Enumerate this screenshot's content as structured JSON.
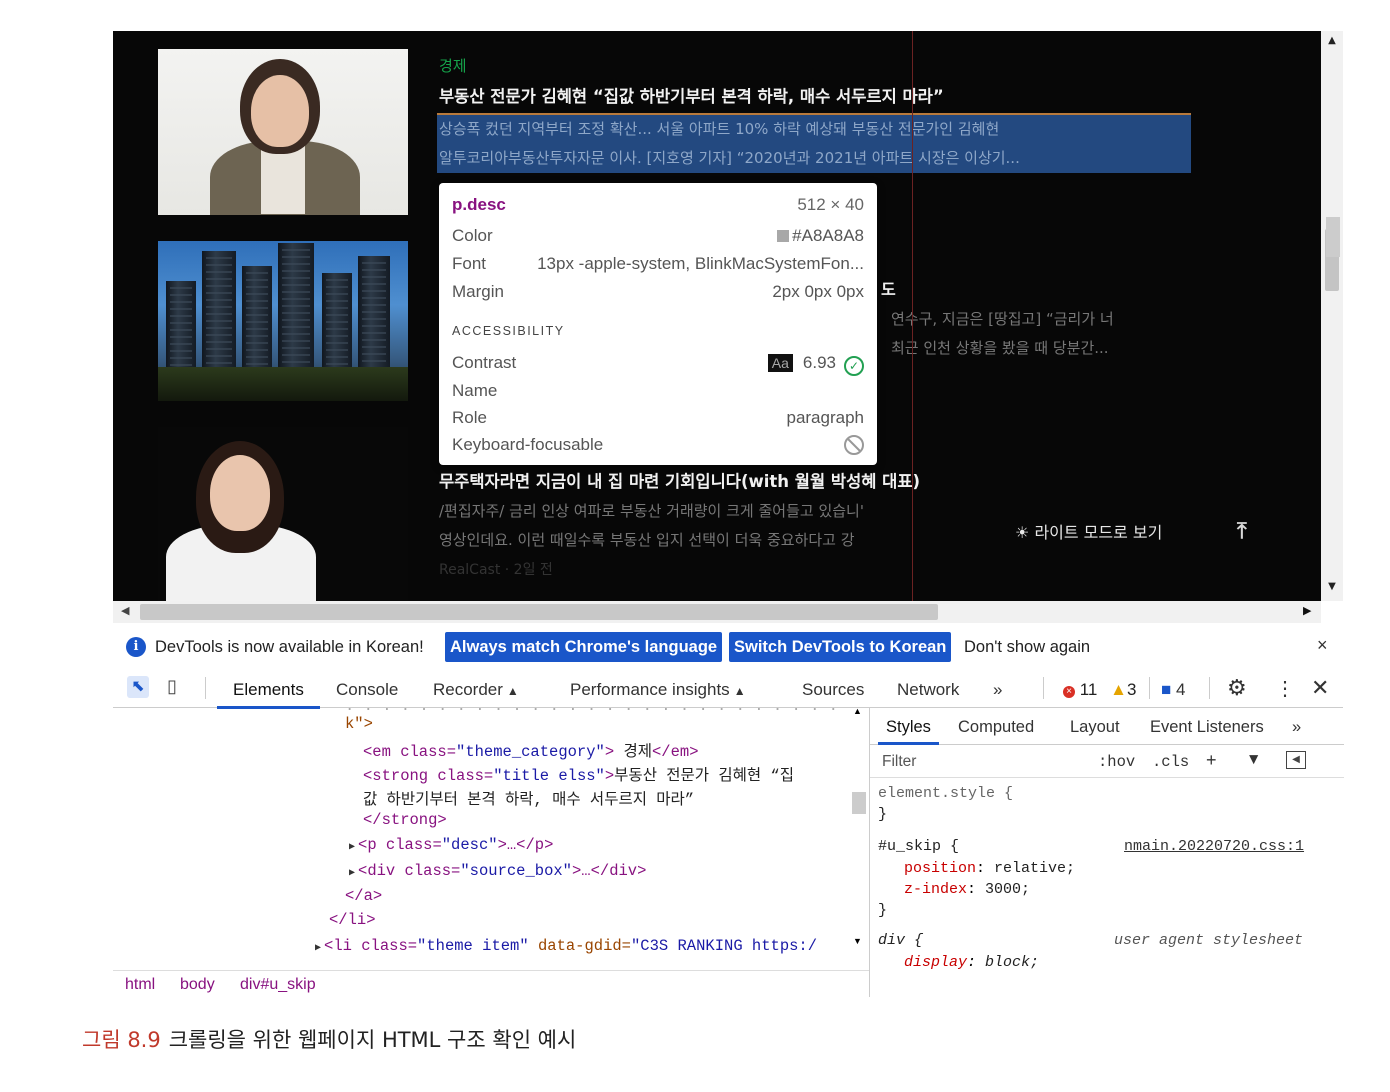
{
  "page": {
    "article1": {
      "category": "경제",
      "title": "부동산 전문가 김혜현 “집값 하반기부터 본격 하락, 매수 서두르지 마라”",
      "desc_line1": "상승폭 컸던 지역부터 조정 확산... 서울 아파트 10% 하락 예상돼 부동산 전문가인 김혜현",
      "desc_line2": "알투코리아부동산투자자문 이사. [지호영 기자] “2020년과 2021년 아파트 시장은 이상기..."
    },
    "article2": {
      "title_fragment": "도",
      "desc_line1": "연수구, 지금은 [땅집고] “금리가 너",
      "desc_line2": "최근 인천 상황을 봤을 때 당분간..."
    },
    "article3": {
      "title": "무주택자라면 지금이 내 집 마련 기회입니다(with 월월 박성혜 대표)",
      "desc_line1": "/편집자주/ 금리 인상 여파로 부동산 거래량이 크게 줄어들고 있습니'",
      "desc_line2": "영상인데요. 이런 때일수록 부동산 입지 선택이 더욱 중요하다고 강",
      "source": "RealCast · 2일 전"
    },
    "light_mode_label": "라이트 모드로 보기",
    "sun_icon": "☀",
    "top_icon": "⤒"
  },
  "tooltip": {
    "element": "p.desc",
    "size": "512 × 40",
    "color_label": "Color",
    "color_value": "#A8A8A8",
    "font_label": "Font",
    "font_value": "13px -apple-system, BlinkMacSystemFon...",
    "margin_label": "Margin",
    "margin_value": "2px 0px 0px",
    "accessibility_heading": "ACCESSIBILITY",
    "contrast_label": "Contrast",
    "contrast_sample": "Aa",
    "contrast_value": "6.93",
    "name_label": "Name",
    "role_label": "Role",
    "role_value": "paragraph",
    "keyboard_label": "Keyboard-focusable"
  },
  "infobar": {
    "text": "DevTools is now available in Korean!",
    "match_button": "Always match Chrome's language",
    "switch_button": "Switch DevTools to Korean",
    "dont_show": "Don't show again",
    "close": "×"
  },
  "tabs": {
    "elements": "Elements",
    "console": "Console",
    "recorder": "Recorder",
    "performance": "Performance insights",
    "sources": "Sources",
    "network": "Network",
    "more": "»",
    "errors": "11",
    "warnings": "3",
    "messages": "4"
  },
  "elements_panel": {
    "line0": "k\">",
    "em_open": "<em class=",
    "em_class": "\"theme_category\"",
    "em_text": "경제",
    "em_close": "</em>",
    "strong_open": "<strong class=",
    "strong_class": "\"title elss\"",
    "strong_text1": "부동산 전문가 김혜현 “집",
    "strong_text2": "값 하반기부터 본격 하락, 매수 서두르지 마라”",
    "strong_close": "</strong>",
    "p_open": "<p class=",
    "p_class": "\"desc\"",
    "p_rest": ">…</p>",
    "div_open": "<div class=",
    "div_class": "\"source_box\"",
    "div_rest": ">…</div>",
    "a_close": "</a>",
    "li_close": "</li>",
    "li_open": "<li class=",
    "li_class": "\"theme item\"",
    "li_attr": " data-gdid=",
    "li_val": "\"C3S RANKING https:/"
  },
  "breadcrumbs": [
    "html",
    "body",
    "div#u_skip"
  ],
  "styles_panel": {
    "tabs": [
      "Styles",
      "Computed",
      "Layout",
      "Event Listeners",
      "»"
    ],
    "filter_placeholder": "Filter",
    "hov": ":hov",
    "cls": ".cls",
    "element_style": "element.style {",
    "close_brace": "}",
    "selector": "#u_skip {",
    "source": "nmain.20220720.css:1",
    "prop1": "position",
    "val1": "relative;",
    "prop2": "z-index",
    "val2": "3000;",
    "div_selector": "div {",
    "ua_label": "user agent stylesheet",
    "prop3": "display",
    "val3": "block;"
  },
  "caption": {
    "label": "그림 8.9",
    "text": "크롤링을 위한 웹페이지 HTML 구조 확인 예시"
  },
  "colors": {
    "accent": "#1a56c9",
    "category_green": "#15a34a",
    "tag_purple": "#881280",
    "caption_red": "#c0392b"
  }
}
